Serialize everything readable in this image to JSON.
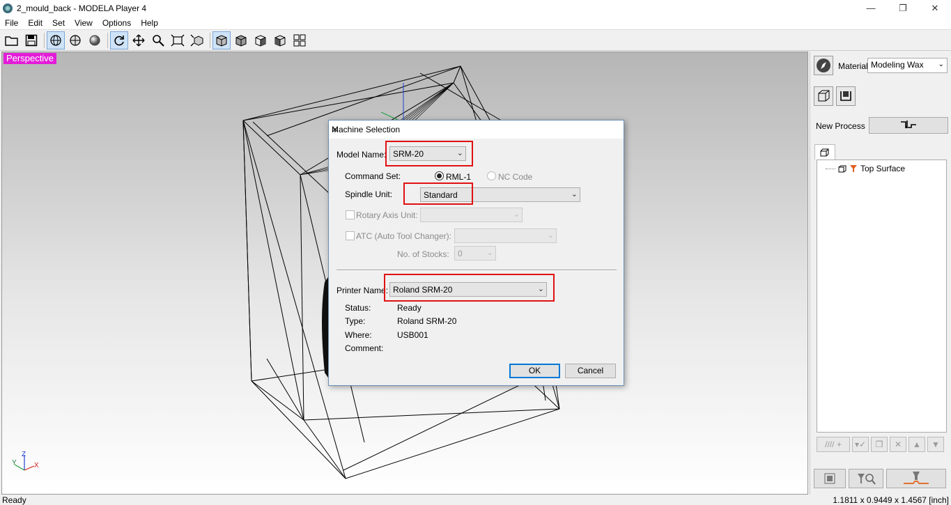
{
  "window": {
    "title": "2_mould_back - MODELA Player 4",
    "minimize": "—",
    "restore": "❐",
    "close": "✕"
  },
  "menu": [
    "File",
    "Edit",
    "Set",
    "View",
    "Options",
    "Help"
  ],
  "viewport": {
    "view_label": "Perspective",
    "axes": {
      "y": "Y",
      "z": "Z",
      "x": "X"
    }
  },
  "right_panel": {
    "material_label": "Material",
    "material_value": "Modeling Wax",
    "new_process_label": "New Process",
    "tree_items": [
      {
        "label": "Top Surface"
      }
    ]
  },
  "status": {
    "left": "Ready",
    "right": "1.1811 x 0.9449 x 1.4567 [inch]"
  },
  "dialog": {
    "title": "Machine Selection",
    "model_name_label": "Model Name:",
    "model_name_value": "SRM-20",
    "command_set_label": "Command Set:",
    "command_set_options": [
      "RML-1",
      "NC Code"
    ],
    "command_set_selected": "RML-1",
    "spindle_unit_label": "Spindle Unit:",
    "spindle_unit_value": "Standard",
    "rotary_axis_label": "Rotary Axis Unit:",
    "atc_label": "ATC (Auto Tool Changer):",
    "stocks_label": "No. of Stocks:",
    "stocks_value": "0",
    "printer_name_label": "Printer Name:",
    "printer_name_value": "Roland SRM-20",
    "status_label": "Status:",
    "status_value": "Ready",
    "type_label": "Type:",
    "type_value": "Roland SRM-20",
    "where_label": "Where:",
    "where_value": "USB001",
    "comment_label": "Comment:",
    "comment_value": "",
    "ok_label": "OK",
    "cancel_label": "Cancel"
  },
  "colors": {
    "perspective_bg": "#e31cd8",
    "highlight_red": "#e01010",
    "accent_blue": "#0078d7"
  }
}
